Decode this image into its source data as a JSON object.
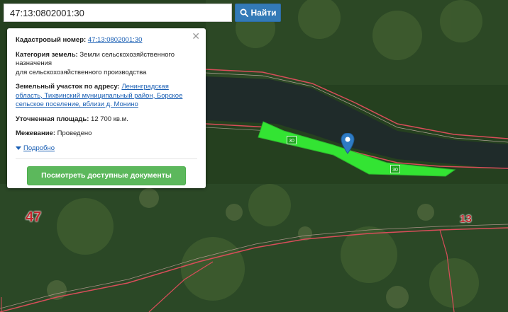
{
  "search": {
    "value": "47:13:0802001:30",
    "button_label": "Найти"
  },
  "popup": {
    "cadastral_label": "Кадастровый номер:",
    "cadastral_value": "47:13:0802001:30",
    "category_label": "Категория земель:",
    "category_value": "Земли сельскохозяйственного назначения",
    "category_value2": "для сельскохозяйственного производства",
    "address_label": "Земельный участок по адресу:",
    "address_value": "Ленинградская область, Тихвинский муниципальный район, Борское сельское поселение, вблизи д. Монино",
    "area_label": "Уточненная площадь:",
    "area_value": "12 700 кв.м.",
    "survey_label": "Межевание:",
    "survey_value": "Проведено",
    "details_label": "Подробно",
    "documents_button": "Посмотреть доступные документы"
  },
  "map": {
    "labels": {
      "left_parcel": "47",
      "right_parcel": "13",
      "badge_a": "30",
      "badge_b": "30"
    },
    "colors": {
      "parcel_fill": "#33e433",
      "boundary": "#d94d5a",
      "river": "#1f2b2a",
      "marker": "#2e7bc4"
    }
  }
}
